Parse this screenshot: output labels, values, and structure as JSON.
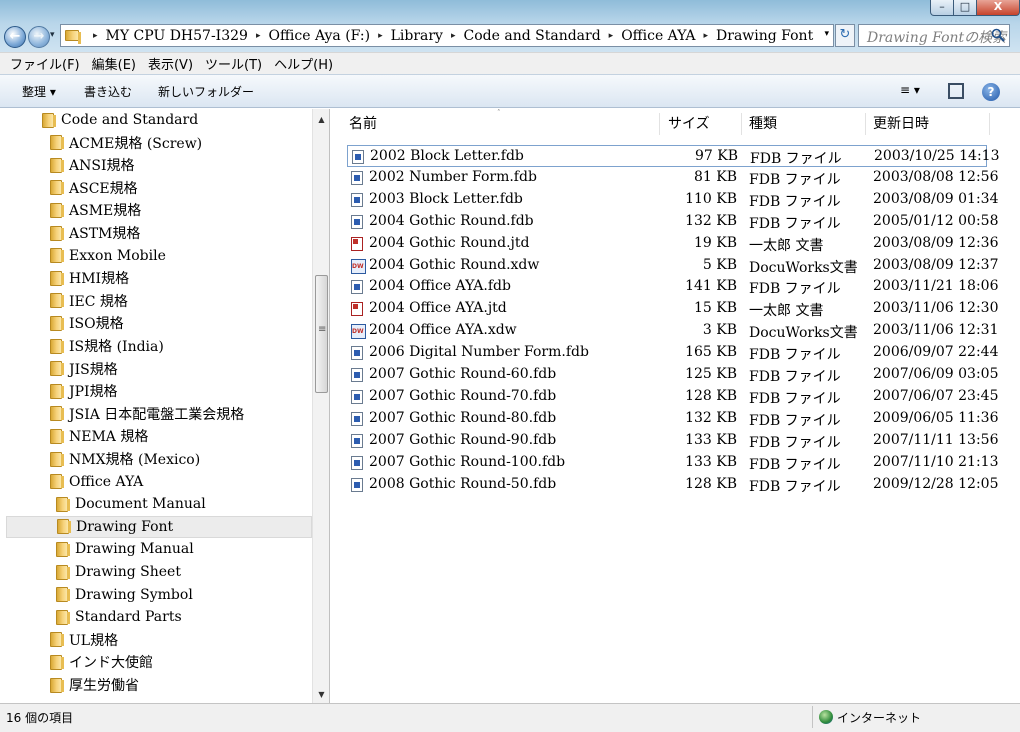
{
  "window": {
    "minimize_glyph": "–",
    "maximize_glyph": "□",
    "close_glyph": "X"
  },
  "nav": {
    "back_glyph": "←",
    "forward_glyph": "→",
    "history_glyph": "▾"
  },
  "address": {
    "crumbs": [
      "MY CPU DH57-I329",
      "Office Aya (F:)",
      "Library",
      "Code and Standard",
      "Office AYA",
      "Drawing Font"
    ],
    "separator": "▸",
    "dropdown_glyph": "▾",
    "refresh_glyph": "↻"
  },
  "search": {
    "placeholder": "Drawing Fontの検索"
  },
  "menu": [
    "ファイル(F)",
    "編集(E)",
    "表示(V)",
    "ツール(T)",
    "ヘルプ(H)"
  ],
  "commands": {
    "organize": "整理 ▾",
    "burn": "書き込む",
    "new_folder": "新しいフォルダー",
    "views": "≡ ▾",
    "help": "?"
  },
  "tree": {
    "items": [
      {
        "label": "Code and Standard",
        "level": 0
      },
      {
        "label": "ACME規格 (Screw)",
        "level": 1
      },
      {
        "label": "ANSI規格",
        "level": 1
      },
      {
        "label": "ASCE規格",
        "level": 1
      },
      {
        "label": "ASME規格",
        "level": 1
      },
      {
        "label": "ASTM規格",
        "level": 1
      },
      {
        "label": "Exxon Mobile",
        "level": 1
      },
      {
        "label": "HMI規格",
        "level": 1
      },
      {
        "label": "IEC 規格",
        "level": 1
      },
      {
        "label": "ISO規格",
        "level": 1
      },
      {
        "label": "IS規格 (India)",
        "level": 1
      },
      {
        "label": "JIS規格",
        "level": 1
      },
      {
        "label": "JPI規格",
        "level": 1
      },
      {
        "label": "JSIA 日本配電盤工業会規格",
        "level": 1
      },
      {
        "label": "NEMA 規格",
        "level": 1
      },
      {
        "label": "NMX規格 (Mexico)",
        "level": 1
      },
      {
        "label": "Office AYA",
        "level": 1
      },
      {
        "label": "Document Manual",
        "level": 2
      },
      {
        "label": "Drawing Font",
        "level": 2,
        "selected": true
      },
      {
        "label": "Drawing Manual",
        "level": 2
      },
      {
        "label": "Drawing Sheet",
        "level": 2
      },
      {
        "label": "Drawing Symbol",
        "level": 2
      },
      {
        "label": "Standard Parts",
        "level": 2
      },
      {
        "label": "UL規格",
        "level": 1
      },
      {
        "label": "インド大使館",
        "level": 1
      },
      {
        "label": "厚生労働省",
        "level": 1
      }
    ],
    "scroll_up_glyph": "▲",
    "scroll_down_glyph": "▼"
  },
  "files": {
    "columns": {
      "name": "名前",
      "size": "サイズ",
      "type": "種類",
      "date": "更新日時"
    },
    "sort_glyph": "ˆ",
    "rows": [
      {
        "name": "2002 Block Letter.fdb",
        "size": "97 KB",
        "type": "FDB ファイル",
        "date": "2003/10/25 14:13",
        "icon": "fdb"
      },
      {
        "name": "2002 Number Form.fdb",
        "size": "81 KB",
        "type": "FDB ファイル",
        "date": "2003/08/08 12:56",
        "icon": "fdb"
      },
      {
        "name": "2003 Block Letter.fdb",
        "size": "110 KB",
        "type": "FDB ファイル",
        "date": "2003/08/09 01:34",
        "icon": "fdb"
      },
      {
        "name": "2004 Gothic Round.fdb",
        "size": "132 KB",
        "type": "FDB ファイル",
        "date": "2005/01/12 00:58",
        "icon": "fdb"
      },
      {
        "name": "2004 Gothic Round.jtd",
        "size": "19 KB",
        "type": "一太郎 文書",
        "date": "2003/08/09 12:36",
        "icon": "jtd"
      },
      {
        "name": "2004 Gothic Round.xdw",
        "size": "5 KB",
        "type": "DocuWorks文書",
        "date": "2003/08/09 12:37",
        "icon": "xdw"
      },
      {
        "name": "2004 Office AYA.fdb",
        "size": "141 KB",
        "type": "FDB ファイル",
        "date": "2003/11/21 18:06",
        "icon": "fdb"
      },
      {
        "name": "2004 Office AYA.jtd",
        "size": "15 KB",
        "type": "一太郎 文書",
        "date": "2003/11/06 12:30",
        "icon": "jtd"
      },
      {
        "name": "2004 Office AYA.xdw",
        "size": "3 KB",
        "type": "DocuWorks文書",
        "date": "2003/11/06 12:31",
        "icon": "xdw"
      },
      {
        "name": "2006 Digital Number Form.fdb",
        "size": "165 KB",
        "type": "FDB ファイル",
        "date": "2006/09/07 22:44",
        "icon": "fdb"
      },
      {
        "name": "2007 Gothic Round-60.fdb",
        "size": "125 KB",
        "type": "FDB ファイル",
        "date": "2007/06/09 03:05",
        "icon": "fdb"
      },
      {
        "name": "2007 Gothic Round-70.fdb",
        "size": "128 KB",
        "type": "FDB ファイル",
        "date": "2007/06/07 23:45",
        "icon": "fdb"
      },
      {
        "name": "2007 Gothic Round-80.fdb",
        "size": "132 KB",
        "type": "FDB ファイル",
        "date": "2009/06/05 11:36",
        "icon": "fdb"
      },
      {
        "name": "2007 Gothic Round-90.fdb",
        "size": "133 KB",
        "type": "FDB ファイル",
        "date": "2007/11/11 13:56",
        "icon": "fdb"
      },
      {
        "name": "2007 Gothic Round-100.fdb",
        "size": "133 KB",
        "type": "FDB ファイル",
        "date": "2007/11/10 21:13",
        "icon": "fdb"
      },
      {
        "name": "2008 Gothic Round-50.fdb",
        "size": "128 KB",
        "type": "FDB ファイル",
        "date": "2009/12/28 12:05",
        "icon": "fdb"
      }
    ]
  },
  "status": {
    "count": "16 個の項目",
    "zone": "インターネット"
  }
}
